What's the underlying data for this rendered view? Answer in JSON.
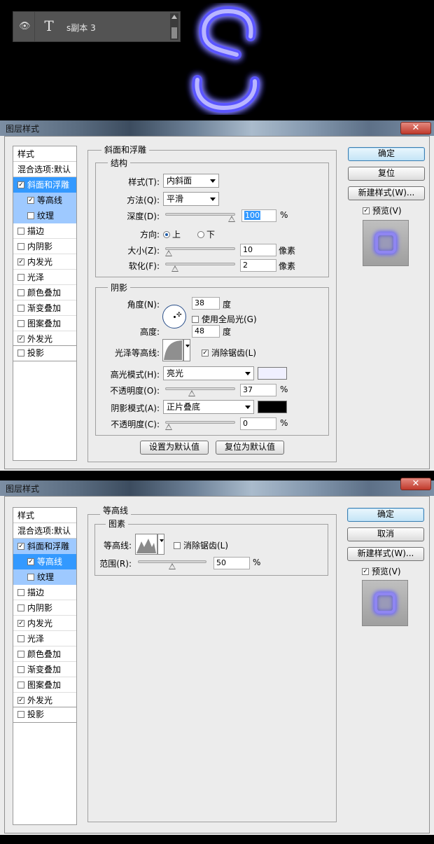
{
  "layer": {
    "name": "s副本 3",
    "type_glyph": "T"
  },
  "glow_letter": "S",
  "colors": {
    "glow": "#6f6cff",
    "highlight_swatch": "#f0f0ff",
    "shadow_swatch": "#000000",
    "selection": "#3399ff"
  },
  "dialog1": {
    "title": "图层样式",
    "styles_header": "样式",
    "blend_options": "混合选项:默认",
    "items": [
      {
        "label": "斜面和浮雕",
        "checked": true
      },
      {
        "label": "等高线",
        "checked": true
      },
      {
        "label": "纹理",
        "checked": false
      },
      {
        "label": "描边",
        "checked": false
      },
      {
        "label": "内阴影",
        "checked": false
      },
      {
        "label": "内发光",
        "checked": true
      },
      {
        "label": "光泽",
        "checked": false
      },
      {
        "label": "颜色叠加",
        "checked": false
      },
      {
        "label": "渐变叠加",
        "checked": false
      },
      {
        "label": "图案叠加",
        "checked": false
      },
      {
        "label": "外发光",
        "checked": true
      },
      {
        "label": "投影",
        "checked": false
      }
    ],
    "section_title": "斜面和浮雕",
    "structure_title": "结构",
    "style_label": "样式(T):",
    "style_value": "内斜面",
    "technique_label": "方法(Q):",
    "technique_value": "平滑",
    "depth_label": "深度(D):",
    "depth_value": "100",
    "percent": "%",
    "direction_label": "方向:",
    "dir_up": "上",
    "dir_down": "下",
    "size_label": "大小(Z):",
    "size_value": "10",
    "px": "像素",
    "soften_label": "软化(F):",
    "soften_value": "2",
    "shading_title": "阴影",
    "angle_label": "角度(N):",
    "angle_value": "38",
    "degree": "度",
    "global_light": "使用全局光(G)",
    "altitude_label": "高度:",
    "altitude_value": "48",
    "gloss_label": "光泽等高线:",
    "antialias": "消除锯齿(L)",
    "highlight_mode_label": "高光模式(H):",
    "highlight_mode_value": "亮光",
    "opacity1_label": "不透明度(O):",
    "opacity1_value": "37",
    "shadow_mode_label": "阴影模式(A):",
    "shadow_mode_value": "正片叠底",
    "opacity2_label": "不透明度(C):",
    "opacity2_value": "0",
    "make_default": "设置为默认值",
    "reset_default": "复位为默认值",
    "ok": "确定",
    "reset": "复位",
    "new_style": "新建样式(W)...",
    "preview": "预览(V)",
    "depth_pct": 1.0,
    "size_frac": 0.0,
    "soften_frac": 0.1,
    "opacity1_pct": 37,
    "opacity2_pct": 0
  },
  "dialog2": {
    "title": "图层样式",
    "styles_header": "样式",
    "blend_options": "混合选项:默认",
    "items": [
      {
        "label": "斜面和浮雕",
        "checked": true
      },
      {
        "label": "等高线",
        "checked": true
      },
      {
        "label": "纹理",
        "checked": false
      },
      {
        "label": "描边",
        "checked": false
      },
      {
        "label": "内阴影",
        "checked": false
      },
      {
        "label": "内发光",
        "checked": true
      },
      {
        "label": "光泽",
        "checked": false
      },
      {
        "label": "颜色叠加",
        "checked": false
      },
      {
        "label": "渐变叠加",
        "checked": false
      },
      {
        "label": "图案叠加",
        "checked": false
      },
      {
        "label": "外发光",
        "checked": true
      },
      {
        "label": "投影",
        "checked": false
      }
    ],
    "section_title": "等高线",
    "elements_title": "图素",
    "contour_label": "等高线:",
    "antialias": "消除锯齿(L)",
    "range_label": "范围(R):",
    "range_value": "50",
    "percent": "%",
    "ok": "确定",
    "cancel": "取消",
    "new_style": "新建样式(W)...",
    "preview": "预览(V)",
    "range_pct": 50
  }
}
